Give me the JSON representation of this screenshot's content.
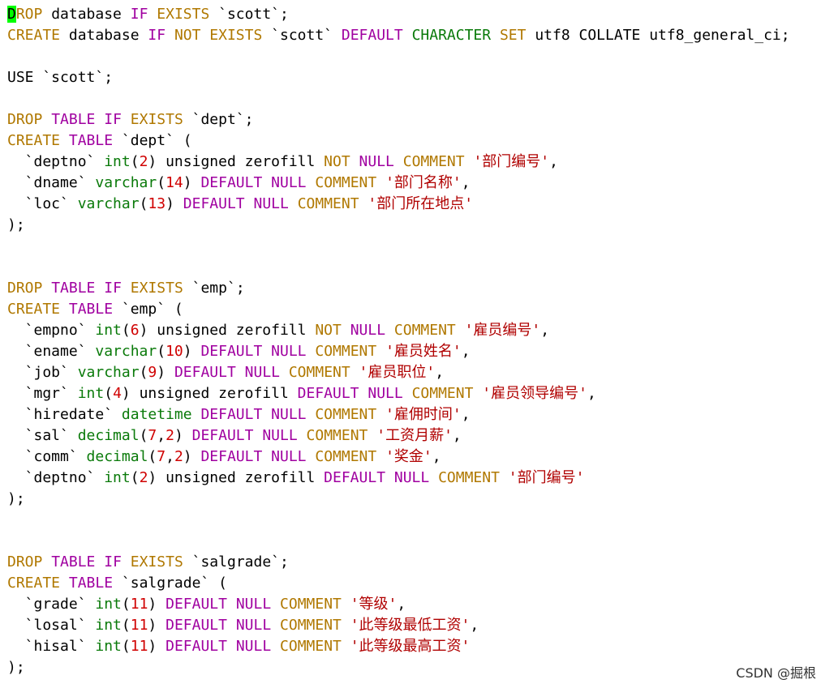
{
  "colors": {
    "k": "#b07800",
    "m": "#a000a0",
    "g": "#0a7a0a",
    "r": "#d00000",
    "s": "#b00000",
    "t": "#000000",
    "cursor": "#00ff00"
  },
  "watermark": "CSDN @掘根",
  "lines": [
    [
      [
        "c",
        "D"
      ],
      [
        "k",
        "ROP"
      ],
      [
        "t",
        " database "
      ],
      [
        "m",
        "IF"
      ],
      [
        "t",
        " "
      ],
      [
        "k",
        "EXISTS"
      ],
      [
        "t",
        " `scott`;"
      ]
    ],
    [
      [
        "k",
        "CREATE"
      ],
      [
        "t",
        " database "
      ],
      [
        "m",
        "IF"
      ],
      [
        "t",
        " "
      ],
      [
        "k",
        "NOT"
      ],
      [
        "t",
        " "
      ],
      [
        "k",
        "EXISTS"
      ],
      [
        "t",
        " `scott` "
      ],
      [
        "m",
        "DEFAULT"
      ],
      [
        "t",
        " "
      ],
      [
        "g",
        "CHARACTER"
      ],
      [
        "t",
        " "
      ],
      [
        "k",
        "SET"
      ],
      [
        "t",
        " utf8 COLLATE utf8_general_ci;"
      ]
    ],
    [],
    [
      [
        "t",
        "USE `scott`;"
      ]
    ],
    [],
    [
      [
        "k",
        "DROP"
      ],
      [
        "t",
        " "
      ],
      [
        "m",
        "TABLE"
      ],
      [
        "t",
        " "
      ],
      [
        "m",
        "IF"
      ],
      [
        "t",
        " "
      ],
      [
        "k",
        "EXISTS"
      ],
      [
        "t",
        " `dept`;"
      ]
    ],
    [
      [
        "k",
        "CREATE"
      ],
      [
        "t",
        " "
      ],
      [
        "m",
        "TABLE"
      ],
      [
        "t",
        " `dept` ("
      ]
    ],
    [
      [
        "t",
        "  `deptno` "
      ],
      [
        "g",
        "int"
      ],
      [
        "t",
        "("
      ],
      [
        "r",
        "2"
      ],
      [
        "t",
        ") unsigned zerofill "
      ],
      [
        "k",
        "NOT"
      ],
      [
        "t",
        " "
      ],
      [
        "m",
        "NULL"
      ],
      [
        "t",
        " "
      ],
      [
        "k",
        "COMMENT"
      ],
      [
        "t",
        " "
      ],
      [
        "s",
        "'部门编号'"
      ],
      [
        "t",
        ","
      ]
    ],
    [
      [
        "t",
        "  `dname` "
      ],
      [
        "g",
        "varchar"
      ],
      [
        "t",
        "("
      ],
      [
        "r",
        "14"
      ],
      [
        "t",
        ") "
      ],
      [
        "m",
        "DEFAULT"
      ],
      [
        "t",
        " "
      ],
      [
        "m",
        "NULL"
      ],
      [
        "t",
        " "
      ],
      [
        "k",
        "COMMENT"
      ],
      [
        "t",
        " "
      ],
      [
        "s",
        "'部门名称'"
      ],
      [
        "t",
        ","
      ]
    ],
    [
      [
        "t",
        "  `loc` "
      ],
      [
        "g",
        "varchar"
      ],
      [
        "t",
        "("
      ],
      [
        "r",
        "13"
      ],
      [
        "t",
        ") "
      ],
      [
        "m",
        "DEFAULT"
      ],
      [
        "t",
        " "
      ],
      [
        "m",
        "NULL"
      ],
      [
        "t",
        " "
      ],
      [
        "k",
        "COMMENT"
      ],
      [
        "t",
        " "
      ],
      [
        "s",
        "'部门所在地点'"
      ]
    ],
    [
      [
        "t",
        ");"
      ]
    ],
    [],
    [],
    [
      [
        "k",
        "DROP"
      ],
      [
        "t",
        " "
      ],
      [
        "m",
        "TABLE"
      ],
      [
        "t",
        " "
      ],
      [
        "m",
        "IF"
      ],
      [
        "t",
        " "
      ],
      [
        "k",
        "EXISTS"
      ],
      [
        "t",
        " `emp`;"
      ]
    ],
    [
      [
        "k",
        "CREATE"
      ],
      [
        "t",
        " "
      ],
      [
        "m",
        "TABLE"
      ],
      [
        "t",
        " `emp` ("
      ]
    ],
    [
      [
        "t",
        "  `empno` "
      ],
      [
        "g",
        "int"
      ],
      [
        "t",
        "("
      ],
      [
        "r",
        "6"
      ],
      [
        "t",
        ") unsigned zerofill "
      ],
      [
        "k",
        "NOT"
      ],
      [
        "t",
        " "
      ],
      [
        "m",
        "NULL"
      ],
      [
        "t",
        " "
      ],
      [
        "k",
        "COMMENT"
      ],
      [
        "t",
        " "
      ],
      [
        "s",
        "'雇员编号'"
      ],
      [
        "t",
        ","
      ]
    ],
    [
      [
        "t",
        "  `ename` "
      ],
      [
        "g",
        "varchar"
      ],
      [
        "t",
        "("
      ],
      [
        "r",
        "10"
      ],
      [
        "t",
        ") "
      ],
      [
        "m",
        "DEFAULT"
      ],
      [
        "t",
        " "
      ],
      [
        "m",
        "NULL"
      ],
      [
        "t",
        " "
      ],
      [
        "k",
        "COMMENT"
      ],
      [
        "t",
        " "
      ],
      [
        "s",
        "'雇员姓名'"
      ],
      [
        "t",
        ","
      ]
    ],
    [
      [
        "t",
        "  `job` "
      ],
      [
        "g",
        "varchar"
      ],
      [
        "t",
        "("
      ],
      [
        "r",
        "9"
      ],
      [
        "t",
        ") "
      ],
      [
        "m",
        "DEFAULT"
      ],
      [
        "t",
        " "
      ],
      [
        "m",
        "NULL"
      ],
      [
        "t",
        " "
      ],
      [
        "k",
        "COMMENT"
      ],
      [
        "t",
        " "
      ],
      [
        "s",
        "'雇员职位'"
      ],
      [
        "t",
        ","
      ]
    ],
    [
      [
        "t",
        "  `mgr` "
      ],
      [
        "g",
        "int"
      ],
      [
        "t",
        "("
      ],
      [
        "r",
        "4"
      ],
      [
        "t",
        ") unsigned zerofill "
      ],
      [
        "m",
        "DEFAULT"
      ],
      [
        "t",
        " "
      ],
      [
        "m",
        "NULL"
      ],
      [
        "t",
        " "
      ],
      [
        "k",
        "COMMENT"
      ],
      [
        "t",
        " "
      ],
      [
        "s",
        "'雇员领导编号'"
      ],
      [
        "t",
        ","
      ]
    ],
    [
      [
        "t",
        "  `hiredate` "
      ],
      [
        "g",
        "datetime"
      ],
      [
        "t",
        " "
      ],
      [
        "m",
        "DEFAULT"
      ],
      [
        "t",
        " "
      ],
      [
        "m",
        "NULL"
      ],
      [
        "t",
        " "
      ],
      [
        "k",
        "COMMENT"
      ],
      [
        "t",
        " "
      ],
      [
        "s",
        "'雇佣时间'"
      ],
      [
        "t",
        ","
      ]
    ],
    [
      [
        "t",
        "  `sal` "
      ],
      [
        "g",
        "decimal"
      ],
      [
        "t",
        "("
      ],
      [
        "r",
        "7"
      ],
      [
        "t",
        ","
      ],
      [
        "r",
        "2"
      ],
      [
        "t",
        ") "
      ],
      [
        "m",
        "DEFAULT"
      ],
      [
        "t",
        " "
      ],
      [
        "m",
        "NULL"
      ],
      [
        "t",
        " "
      ],
      [
        "k",
        "COMMENT"
      ],
      [
        "t",
        " "
      ],
      [
        "s",
        "'工资月薪'"
      ],
      [
        "t",
        ","
      ]
    ],
    [
      [
        "t",
        "  `comm` "
      ],
      [
        "g",
        "decimal"
      ],
      [
        "t",
        "("
      ],
      [
        "r",
        "7"
      ],
      [
        "t",
        ","
      ],
      [
        "r",
        "2"
      ],
      [
        "t",
        ") "
      ],
      [
        "m",
        "DEFAULT"
      ],
      [
        "t",
        " "
      ],
      [
        "m",
        "NULL"
      ],
      [
        "t",
        " "
      ],
      [
        "k",
        "COMMENT"
      ],
      [
        "t",
        " "
      ],
      [
        "s",
        "'奖金'"
      ],
      [
        "t",
        ","
      ]
    ],
    [
      [
        "t",
        "  `deptno` "
      ],
      [
        "g",
        "int"
      ],
      [
        "t",
        "("
      ],
      [
        "r",
        "2"
      ],
      [
        "t",
        ") unsigned zerofill "
      ],
      [
        "m",
        "DEFAULT"
      ],
      [
        "t",
        " "
      ],
      [
        "m",
        "NULL"
      ],
      [
        "t",
        " "
      ],
      [
        "k",
        "COMMENT"
      ],
      [
        "t",
        " "
      ],
      [
        "s",
        "'部门编号'"
      ]
    ],
    [
      [
        "t",
        ");"
      ]
    ],
    [],
    [],
    [
      [
        "k",
        "DROP"
      ],
      [
        "t",
        " "
      ],
      [
        "m",
        "TABLE"
      ],
      [
        "t",
        " "
      ],
      [
        "m",
        "IF"
      ],
      [
        "t",
        " "
      ],
      [
        "k",
        "EXISTS"
      ],
      [
        "t",
        " `salgrade`;"
      ]
    ],
    [
      [
        "k",
        "CREATE"
      ],
      [
        "t",
        " "
      ],
      [
        "m",
        "TABLE"
      ],
      [
        "t",
        " `salgrade` ("
      ]
    ],
    [
      [
        "t",
        "  `grade` "
      ],
      [
        "g",
        "int"
      ],
      [
        "t",
        "("
      ],
      [
        "r",
        "11"
      ],
      [
        "t",
        ") "
      ],
      [
        "m",
        "DEFAULT"
      ],
      [
        "t",
        " "
      ],
      [
        "m",
        "NULL"
      ],
      [
        "t",
        " "
      ],
      [
        "k",
        "COMMENT"
      ],
      [
        "t",
        " "
      ],
      [
        "s",
        "'等级'"
      ],
      [
        "t",
        ","
      ]
    ],
    [
      [
        "t",
        "  `losal` "
      ],
      [
        "g",
        "int"
      ],
      [
        "t",
        "("
      ],
      [
        "r",
        "11"
      ],
      [
        "t",
        ") "
      ],
      [
        "m",
        "DEFAULT"
      ],
      [
        "t",
        " "
      ],
      [
        "m",
        "NULL"
      ],
      [
        "t",
        " "
      ],
      [
        "k",
        "COMMENT"
      ],
      [
        "t",
        " "
      ],
      [
        "s",
        "'此等级最低工资'"
      ],
      [
        "t",
        ","
      ]
    ],
    [
      [
        "t",
        "  `hisal` "
      ],
      [
        "g",
        "int"
      ],
      [
        "t",
        "("
      ],
      [
        "r",
        "11"
      ],
      [
        "t",
        ") "
      ],
      [
        "m",
        "DEFAULT"
      ],
      [
        "t",
        " "
      ],
      [
        "m",
        "NULL"
      ],
      [
        "t",
        " "
      ],
      [
        "k",
        "COMMENT"
      ],
      [
        "t",
        " "
      ],
      [
        "s",
        "'此等级最高工资'"
      ]
    ],
    [
      [
        "t",
        ");"
      ]
    ]
  ]
}
